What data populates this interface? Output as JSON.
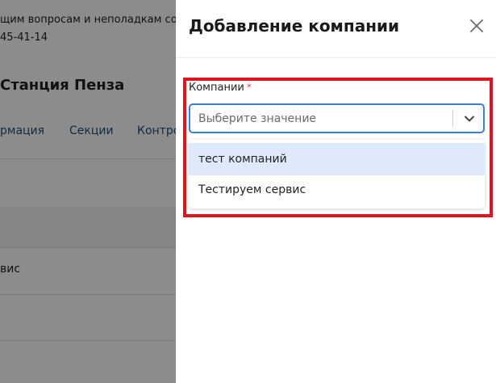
{
  "background": {
    "notice_line1": "щим вопросам и неполадкам сос",
    "notice_line2": "45-41-14",
    "page_title": "Станция Пенза",
    "tabs": [
      "рмация",
      "Секции",
      "Контро"
    ],
    "row_text": "вис"
  },
  "drawer": {
    "title": "Добавление компании",
    "close_icon": "close-icon",
    "field": {
      "label": "Компании",
      "required_mark": "*",
      "placeholder": "Выберите значение",
      "chevron_icon": "chevron-down-icon",
      "options": [
        "тест компаний",
        "Тестируем сервис"
      ],
      "highlighted_option_index": 0
    }
  },
  "colors": {
    "highlight_border": "#e1141e",
    "select_border": "#3d7fd6",
    "option_hover": "#deeafc",
    "required": "#e5484d"
  }
}
